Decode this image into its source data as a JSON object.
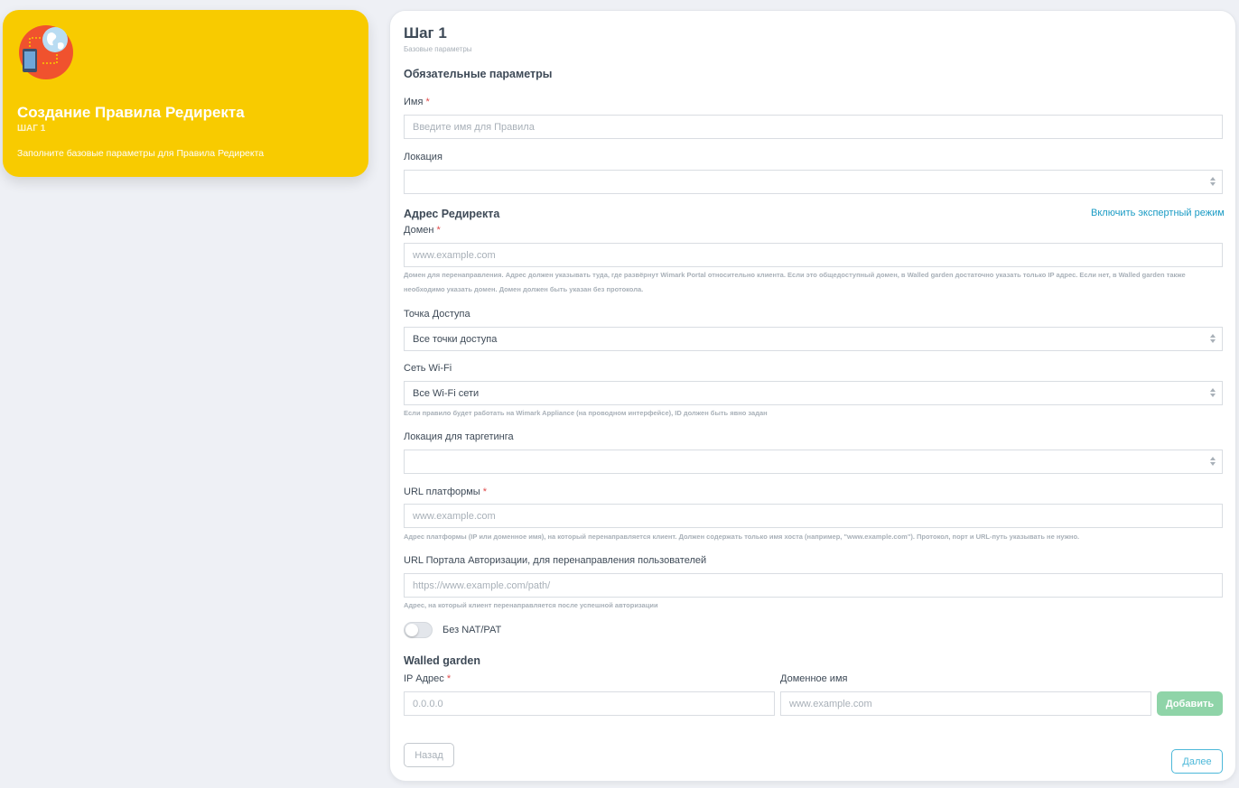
{
  "sidebar": {
    "title": "Создание Правила Редиректа",
    "step": "ШАГ 1",
    "description": "Заполните базовые параметры для Правила Редиректа"
  },
  "form": {
    "step_title": "Шаг 1",
    "step_subtitle": "Базовые параметры",
    "section_required": "Обязательные параметры",
    "name": {
      "label": "Имя",
      "required_mark": "*",
      "placeholder": "Введите имя для Правила",
      "value": ""
    },
    "location": {
      "label": "Локация",
      "value": ""
    },
    "redirect_section": "Адрес Редиректа",
    "expert_mode_link": "Включить экспертный режим",
    "domain": {
      "label": "Домен",
      "required_mark": "*",
      "placeholder": "www.example.com",
      "hint_line1": "Домен для перенаправления. Адрес должен указывать туда, где развёрнут Wimark Portal относительно клиента. Если это общедоступный домен, в Walled garden достаточно указать только IP адрес. Если нет, в Walled garden также",
      "hint_line2": "необходимо указать домен. Домен должен быть указан без протокола."
    },
    "access_point": {
      "label": "Точка Доступа",
      "value": "Все точки доступа"
    },
    "wifi_network": {
      "label": "Сеть Wi-Fi",
      "value": "Все Wi-Fi сети",
      "hint": "Если правило будет работать на Wimark Appliance (на проводном интерфейсе), ID должен быть явно задан"
    },
    "targeting_location": {
      "label": "Локация для таргетинга",
      "value": ""
    },
    "platform_url": {
      "label": "URL платформы",
      "required_mark": "*",
      "placeholder": "www.example.com",
      "hint": "Адрес платформы (IP или доменное имя), на который перенаправляется клиент. Должен содержать только имя хоста (например, \"www.example.com\"). Протокол, порт и URL-путь указывать не нужно."
    },
    "auth_portal_url": {
      "label": "URL Портала Авторизации, для перенаправления пользователей",
      "placeholder": "https://www.example.com/path/",
      "hint": "Адрес, на который клиент перенаправляется после успешной авторизации"
    },
    "no_nat_toggle": {
      "label": "Без NAT/PAT",
      "on": false
    },
    "walled_garden": {
      "section": "Walled garden",
      "ip": {
        "label": "IP Адрес",
        "required_mark": "*",
        "placeholder": "0.0.0.0"
      },
      "domain": {
        "label": "Доменное имя",
        "placeholder": "www.example.com"
      },
      "add_button": "Добавить"
    },
    "back_button": "Назад",
    "next_button": "Далее"
  },
  "colors": {
    "sidebar_bg": "#f8cb00",
    "accent_link": "#1a9bc4",
    "add_button": "#8fd4a8",
    "required": "#e04b4b"
  }
}
